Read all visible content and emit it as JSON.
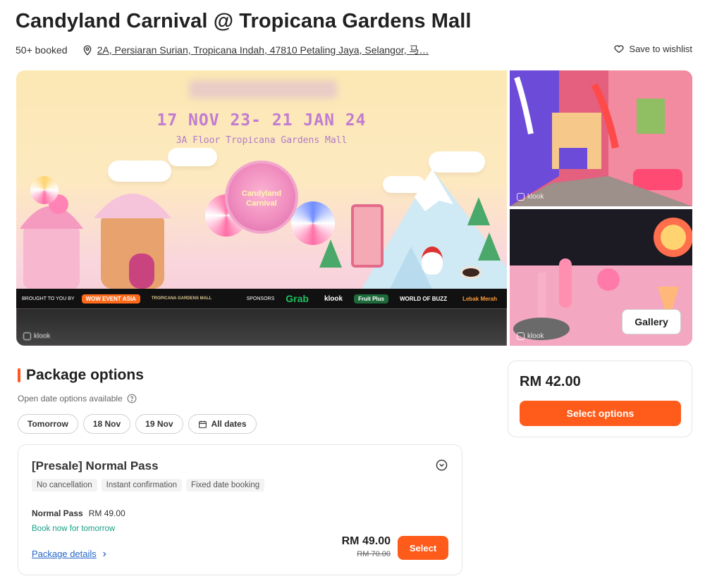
{
  "header": {
    "title": "Candyland Carnival @ Tropicana Gardens Mall",
    "booked": "50+ booked",
    "location": "2A, Persiaran Surian, Tropicana Indah, 47810 Petaling Jaya, Selangor, 马…",
    "wishlist_label": "Save to wishlist"
  },
  "gallery": {
    "hero": {
      "date_text": "17 NOV 23- 21 JAN 24",
      "floor_text": "3A Floor Tropicana Gardens Mall",
      "sign_text_1": "Candyland",
      "sign_text_2": "Carnival",
      "brought_by": "BROUGHT TO YOU BY",
      "sponsors_label": "SPONSORS",
      "logos": [
        "WOW EVENT ASIA",
        "TROPICANA GARDENS MALL",
        "Grab",
        "klook",
        "Fruit Plus",
        "WORLD OF BUZZ",
        "Lebak Merah"
      ],
      "watermark": "klook"
    },
    "thumb1_watermark": "klook",
    "thumb2_watermark": "klook",
    "gallery_button": "Gallery"
  },
  "packages": {
    "heading": "Package options",
    "open_date_text": "Open date options available",
    "date_chips": [
      "Tomorrow",
      "18 Nov",
      "19 Nov"
    ],
    "all_dates_label": "All dates",
    "card": {
      "title": "[Presale] Normal Pass",
      "tags": [
        "No cancellation",
        "Instant confirmation",
        "Fixed date booking"
      ],
      "ticket_label": "Normal Pass",
      "ticket_price": "RM 49.00",
      "book_now": "Book now for tomorrow",
      "details_link": "Package details",
      "price": "RM 49.00",
      "old_price": "RM 70.00",
      "select_label": "Select"
    }
  },
  "sidebar": {
    "price": "RM 42.00",
    "button_label": "Select options"
  },
  "colors": {
    "accent": "#ff5b1a",
    "link": "#2466c8",
    "success": "#16a085"
  }
}
